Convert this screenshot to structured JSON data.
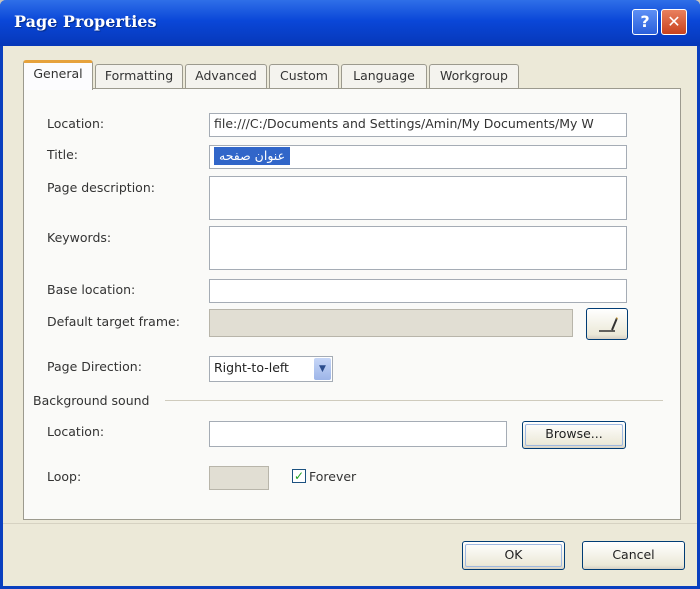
{
  "window": {
    "title": "Page Properties",
    "help_label": "?",
    "close_label": "✕"
  },
  "tabs": [
    {
      "label": "General",
      "active": true
    },
    {
      "label": "Formatting",
      "active": false
    },
    {
      "label": "Advanced",
      "active": false
    },
    {
      "label": "Custom",
      "active": false
    },
    {
      "label": "Language",
      "active": false
    },
    {
      "label": "Workgroup",
      "active": false
    }
  ],
  "general": {
    "location_label": "Location:",
    "location_value": "file:///C:/Documents and Settings/Amin/My Documents/My W",
    "title_label": "Title:",
    "title_value": "عنوان صفحه",
    "page_description_label": "Page description:",
    "page_description_value": "",
    "keywords_label": "Keywords:",
    "keywords_value": "",
    "base_location_label": "Base location:",
    "base_location_value": "",
    "default_target_frame_label": "Default target frame:",
    "default_target_frame_value": "",
    "page_direction_label": "Page Direction:",
    "page_direction_value": "Right-to-left"
  },
  "background_sound": {
    "group_label": "Background sound",
    "location_label": "Location:",
    "location_value": "",
    "browse_label": "Browse...",
    "loop_label": "Loop:",
    "loop_value": "",
    "forever_label": "Forever",
    "forever_checked": true
  },
  "footer": {
    "ok_label": "OK",
    "cancel_label": "Cancel"
  },
  "colors": {
    "titlebar": "#0a47d8",
    "dialog_bg": "#ece9d8",
    "active_tab_accent": "#e6a23c",
    "selection": "#3166c9"
  },
  "icons": {
    "target_frame_button": "pencil-icon",
    "help": "help-icon",
    "close": "close-icon",
    "dropdown": "chevron-down-icon",
    "forever_check": "checkmark-icon"
  }
}
